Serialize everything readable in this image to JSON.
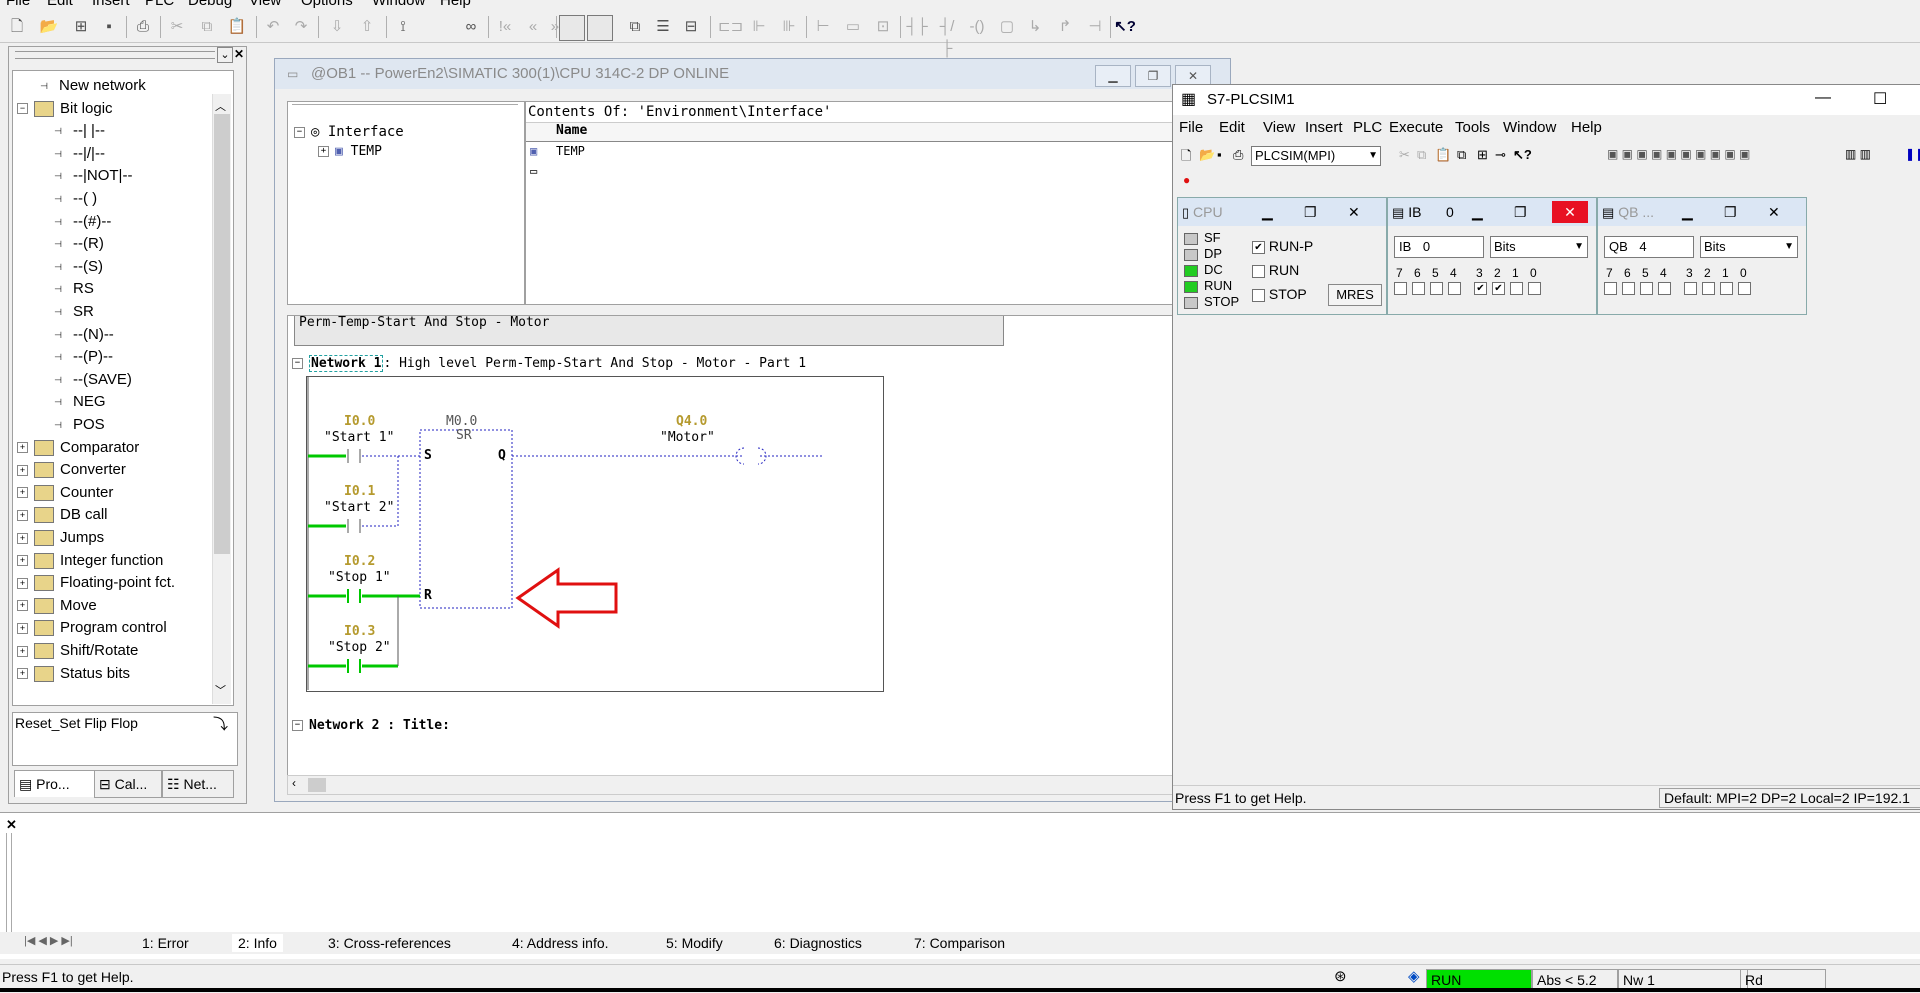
{
  "main_menu": [
    "File",
    "Edit",
    "Insert",
    "PLC",
    "Debug",
    "View",
    "Options",
    "Window",
    "Help"
  ],
  "left_panel": {
    "tree_items": [
      {
        "label": "New network",
        "type": "item",
        "indent": 1
      },
      {
        "label": "Bit logic",
        "type": "folder",
        "indent": 0,
        "expanded": true
      },
      {
        "label": "--| |--",
        "type": "item",
        "indent": 2
      },
      {
        "label": "--|/|--",
        "type": "item",
        "indent": 2
      },
      {
        "label": "--|NOT|--",
        "type": "item",
        "indent": 2
      },
      {
        "label": "--( )",
        "type": "item",
        "indent": 2
      },
      {
        "label": "--(#)--",
        "type": "item",
        "indent": 2
      },
      {
        "label": "--(R)",
        "type": "item",
        "indent": 2
      },
      {
        "label": "--(S)",
        "type": "item",
        "indent": 2
      },
      {
        "label": "RS",
        "type": "item",
        "indent": 2
      },
      {
        "label": "SR",
        "type": "item",
        "indent": 2
      },
      {
        "label": "--(N)--",
        "type": "item",
        "indent": 2
      },
      {
        "label": "--(P)--",
        "type": "item",
        "indent": 2
      },
      {
        "label": "--(SAVE)",
        "type": "item",
        "indent": 2
      },
      {
        "label": "NEG",
        "type": "item",
        "indent": 2
      },
      {
        "label": "POS",
        "type": "item",
        "indent": 2
      },
      {
        "label": "Comparator",
        "type": "folder",
        "indent": 0
      },
      {
        "label": "Converter",
        "type": "folder",
        "indent": 0
      },
      {
        "label": "Counter",
        "type": "folder",
        "indent": 0
      },
      {
        "label": "DB call",
        "type": "folder",
        "indent": 0
      },
      {
        "label": "Jumps",
        "type": "folder",
        "indent": 0
      },
      {
        "label": "Integer function",
        "type": "folder",
        "indent": 0
      },
      {
        "label": "Floating-point fct.",
        "type": "folder",
        "indent": 0
      },
      {
        "label": "Move",
        "type": "folder",
        "indent": 0
      },
      {
        "label": "Program control",
        "type": "folder",
        "indent": 0
      },
      {
        "label": "Shift/Rotate",
        "type": "folder",
        "indent": 0
      },
      {
        "label": "Status bits",
        "type": "folder",
        "indent": 0
      }
    ],
    "description": "Reset_Set Flip Flop",
    "tabs": [
      "Pro...",
      "Cal...",
      "Net..."
    ]
  },
  "editor": {
    "title": "@OB1 -- PowerEn2\\SIMATIC 300(1)\\CPU 314C-2 DP  ONLINE",
    "interface_root": "Interface",
    "interface_child": "TEMP",
    "contents_header": "Contents Of: 'Environment\\Interface'",
    "name_col": "Name",
    "name_row": "TEMP",
    "block_comment": "Perm-Temp-Start And Stop - Motor",
    "network1_label": "Network 1",
    "network1_title": ": High level Perm-Temp-Start And Stop - Motor - Part 1",
    "network2_label": "Network 2",
    "network2_title": ": Title:",
    "contacts": [
      {
        "addr": "I0.0",
        "sym": "\"Start 1\""
      },
      {
        "addr": "I0.1",
        "sym": "\"Start 2\""
      },
      {
        "addr": "I0.2",
        "sym": "\"Stop 1\""
      },
      {
        "addr": "I0.3",
        "sym": "\"Stop 2\""
      }
    ],
    "sr_addr": "M0.0",
    "sr_name": "SR",
    "sr_s": "S",
    "sr_q": "Q",
    "sr_r": "R",
    "coil_addr": "Q4.0",
    "coil_sym": "\"Motor\""
  },
  "plcsim": {
    "title": "S7-PLCSIM1",
    "menu": [
      "File",
      "Edit",
      "View",
      "Insert",
      "PLC",
      "Execute",
      "Tools",
      "Window",
      "Help"
    ],
    "interface_select": "PLCSIM(MPI)",
    "cpu": {
      "title": "CPU",
      "leds": [
        {
          "label": "SF",
          "on": false
        },
        {
          "label": "DP",
          "on": false
        },
        {
          "label": "DC",
          "on": true
        },
        {
          "label": "RUN",
          "on": true
        },
        {
          "label": "STOP",
          "on": false
        }
      ],
      "modes": [
        {
          "label": "RUN-P",
          "checked": true
        },
        {
          "label": "RUN",
          "checked": false
        },
        {
          "label": "STOP",
          "checked": false
        }
      ],
      "mres": "MRES"
    },
    "ib": {
      "title": "IB",
      "title_num": "0",
      "field": "IB",
      "value": "0",
      "format": "Bits",
      "bits": [
        "7",
        "6",
        "5",
        "4",
        "3",
        "2",
        "1",
        "0"
      ],
      "checked": [
        false,
        false,
        false,
        false,
        true,
        true,
        false,
        false
      ]
    },
    "qb": {
      "title": "QB",
      "title_num": "...",
      "field": "QB",
      "value": "4",
      "format": "Bits",
      "bits": [
        "7",
        "6",
        "5",
        "4",
        "3",
        "2",
        "1",
        "0"
      ],
      "checked": [
        false,
        false,
        false,
        false,
        false,
        false,
        false,
        false
      ]
    },
    "status_left": "Press F1 to get Help.",
    "status_right": "Default:  MPI=2 DP=2 Local=2 IP=192.1"
  },
  "output_tabs": [
    "1: Error",
    "2: Info",
    "3: Cross-references",
    "4: Address info.",
    "5: Modify",
    "6: Diagnostics",
    "7: Comparison"
  ],
  "status": {
    "help": "Press F1 to get Help.",
    "mode": "RUN",
    "abs": "Abs < 5.2",
    "nw": "Nw 1",
    "rd": "Rd"
  },
  "colors": {
    "green_led": "#22cc22",
    "power_rail": "#00c800",
    "address_text": "#b59a2e",
    "dotted_blue": "#2020c0",
    "arrow_red": "#e01010",
    "run_green": "#00e000"
  }
}
